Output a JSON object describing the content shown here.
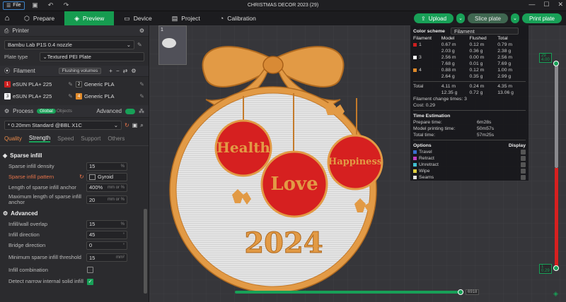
{
  "titlebar": {
    "file": "File",
    "title": "CHRISTMAS DECOR 2023 (29)"
  },
  "toolbar": {
    "tabs": [
      {
        "label": "Prepare",
        "icon": "prepare-icon"
      },
      {
        "label": "Preview",
        "icon": "preview-icon"
      },
      {
        "label": "Device",
        "icon": "device-icon"
      },
      {
        "label": "Project",
        "icon": "project-icon"
      },
      {
        "label": "Calibration",
        "icon": "calibration-icon"
      }
    ],
    "upload": "Upload",
    "slice": "Slice plate",
    "print": "Print plate"
  },
  "printer": {
    "header": "Printer",
    "name": "Bambu Lab P1S 0.4 nozzle",
    "plate_label": "Plate type",
    "plate": "Textured PEI Plate"
  },
  "filament": {
    "header": "Filament",
    "flushing": "Flushing volumes",
    "items": [
      {
        "n": "1",
        "name": "eSUN PLA+ 225",
        "color": "#cc1f1f"
      },
      {
        "n": "2",
        "name": "Generic PLA",
        "color": "#202020"
      },
      {
        "n": "3",
        "name": "eSUN PLA+ 225",
        "color": "#ffffff"
      },
      {
        "n": "4",
        "name": "Generic PLA",
        "color": "#e08a2a"
      }
    ]
  },
  "process": {
    "header": "Process",
    "global": "Global",
    "objects": "Objects",
    "advanced": "Advanced",
    "profile": "* 0.20mm Standard @BBL X1C",
    "tabs": [
      "Quality",
      "Strength",
      "Speed",
      "Support",
      "Others"
    ]
  },
  "sparse": {
    "title": "Sparse infill",
    "rows": [
      {
        "label": "Sparse infill density",
        "value": "15",
        "unit": "%"
      },
      {
        "label": "Sparse infill pattern",
        "value": "Gyroid",
        "unit": ""
      },
      {
        "label": "Length of sparse infill anchor",
        "value": "400%",
        "unit": "mm or %"
      },
      {
        "label": "Maximum length of sparse infill anchor",
        "value": "20",
        "unit": "mm or %"
      }
    ]
  },
  "advanced": {
    "title": "Advanced",
    "rows": [
      {
        "label": "Infill/wall overlap",
        "value": "15",
        "unit": "%"
      },
      {
        "label": "Infill direction",
        "value": "45",
        "unit": "°"
      },
      {
        "label": "Bridge direction",
        "value": "0",
        "unit": "°"
      },
      {
        "label": "Minimum sparse infill threshold",
        "value": "15",
        "unit": "mm²"
      }
    ],
    "combination": "Infill combination",
    "narrow": "Detect narrow internal solid infill"
  },
  "thumb": {
    "n": "1"
  },
  "stats": {
    "scheme": "Color scheme",
    "mode": "Filament",
    "cols": [
      "Filament",
      "Model",
      "Flushed",
      "Total"
    ],
    "rows": [
      {
        "f": "1",
        "c": "#cc1f1f",
        "m1": "0.67 m",
        "m2": "2.03 g",
        "f1": "0.12 m",
        "f2": "0.36 g",
        "t1": "0.79 m",
        "t2": "2.38 g"
      },
      {
        "f": "3",
        "c": "#ffffff",
        "m1": "2.56 m",
        "m2": "7.68 g",
        "f1": "0.00 m",
        "f2": "0.01 g",
        "t1": "2.56 m",
        "t2": "7.69 g"
      },
      {
        "f": "4",
        "c": "#e08a2a",
        "m1": "0.88 m",
        "m2": "2.64 g",
        "f1": "0.12 m",
        "f2": "0.35 g",
        "t1": "1.00 m",
        "t2": "2.99 g"
      }
    ],
    "total": {
      "label": "Total",
      "m1": "4.11 m",
      "m2": "12.35 g",
      "f1": "0.24 m",
      "f2": "0.72 g",
      "t1": "4.35 m",
      "t2": "13.06 g"
    },
    "changes": "Filament change times:",
    "changes_v": "3",
    "cost": "Cost:",
    "cost_v": "0.29",
    "time_title": "Time Estimation",
    "prep": "Prepare time:",
    "prep_v": "6m28s",
    "model": "Model printing time:",
    "model_v": "50m57s",
    "total_t": "Total time:",
    "total_t_v": "57m25s",
    "options": "Options",
    "display": "Display",
    "opt_items": [
      {
        "name": "Travel",
        "c": "#3a6fd0"
      },
      {
        "name": "Retract",
        "c": "#c040c0"
      },
      {
        "name": "Unretract",
        "c": "#40c0d0"
      },
      {
        "name": "Wipe",
        "c": "#e0d040"
      },
      {
        "name": "Seams",
        "c": "#e0e0e0"
      }
    ]
  },
  "model": {
    "words": [
      "Health",
      "Love",
      "Happiness"
    ],
    "year": "2024"
  },
  "layers": {
    "top": "29",
    "top_h": "4.00",
    "bottom": "1",
    "bottom_h": "0.29",
    "h_value": "6918"
  }
}
